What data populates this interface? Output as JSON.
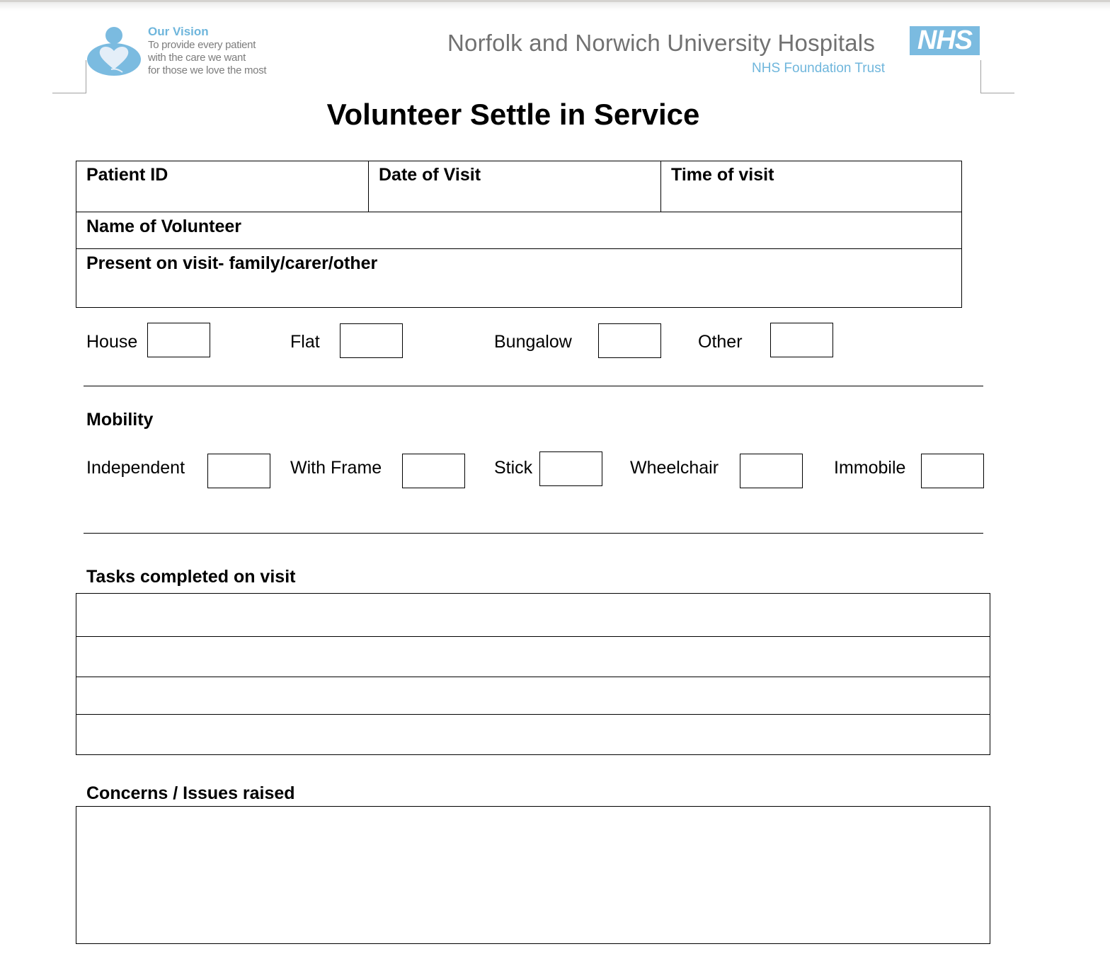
{
  "header": {
    "vision": {
      "title": "Our Vision",
      "lines": [
        "To provide every patient",
        "with the care we want",
        "for those we love the most"
      ]
    },
    "trust_name": "Norfolk and Norwich University Hospitals",
    "nhs_badge": "NHS",
    "trust_subtitle": "NHS Foundation Trust",
    "brand_color": "#7bbbe0"
  },
  "title": "Volunteer Settle in Service",
  "details_table": {
    "patient_id": "Patient ID",
    "date_of_visit": "Date of Visit",
    "time_of_visit": "Time of visit",
    "name_of_volunteer": "Name of Volunteer",
    "present_on_visit": "Present on visit- family/carer/other"
  },
  "residence": {
    "options": [
      "House",
      "Flat",
      "Bungalow",
      "Other"
    ]
  },
  "mobility": {
    "heading": "Mobility",
    "options": [
      "Independent",
      "With Frame",
      "Stick",
      "Wheelchair",
      "Immobile"
    ]
  },
  "tasks": {
    "heading": "Tasks completed on visit",
    "rows": [
      "",
      "",
      "",
      ""
    ]
  },
  "concerns": {
    "heading": "Concerns / Issues raised",
    "value": ""
  }
}
